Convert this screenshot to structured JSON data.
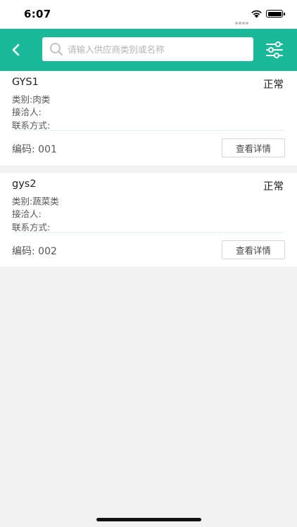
{
  "status_bar": {
    "time": "6:07"
  },
  "nav": {
    "search_placeholder": "请输入供应商类别或名称",
    "search_value": ""
  },
  "suppliers": [
    {
      "name": "GYS1",
      "status": "正常",
      "category": "类别:肉类",
      "contact": "接洽人:",
      "contact_method": "联系方式:",
      "code": "编码:  001",
      "detail_label": "查看详情"
    },
    {
      "name": "gys2",
      "status": "正常",
      "category": "类别:蔬菜类",
      "contact": "接洽人:",
      "contact_method": "联系方式:",
      "code": "编码:  002",
      "detail_label": "查看详情"
    }
  ],
  "colors": {
    "accent": "#1ab99a",
    "background": "#f2f2f2"
  },
  "icons": {
    "back": "chevron-left-icon",
    "search": "search-icon",
    "filter": "filter-sliders-icon"
  }
}
